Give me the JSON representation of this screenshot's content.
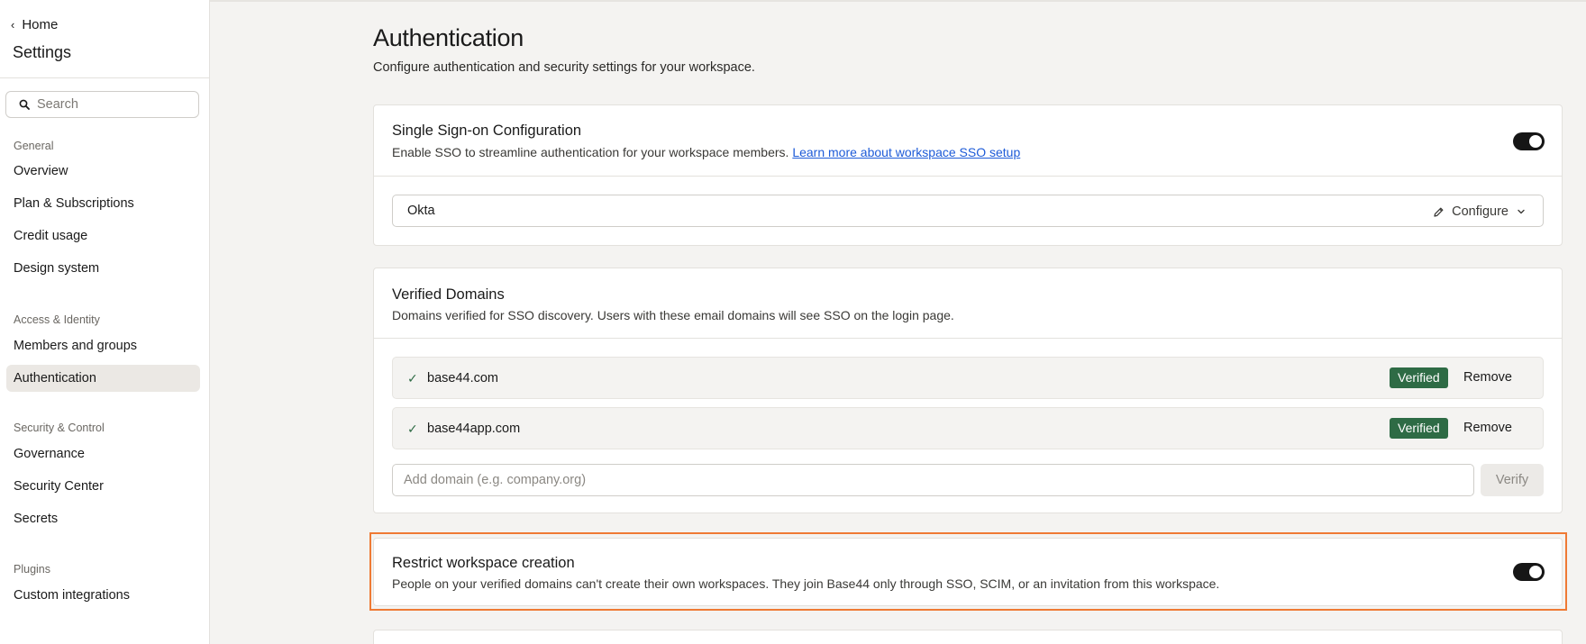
{
  "sidebar": {
    "back_label": "Home",
    "title": "Settings",
    "search_placeholder": "Search",
    "sections": [
      {
        "heading": "General",
        "items": [
          "Overview",
          "Plan & Subscriptions",
          "Credit usage",
          "Design system"
        ]
      },
      {
        "heading": "Access & Identity",
        "items": [
          "Members and groups",
          "Authentication"
        ]
      },
      {
        "heading": "Security & Control",
        "items": [
          "Governance",
          "Security Center",
          "Secrets"
        ]
      },
      {
        "heading": "Plugins",
        "items": [
          "Custom integrations"
        ]
      }
    ],
    "active_item": "Authentication"
  },
  "page": {
    "title": "Authentication",
    "subtitle": "Configure authentication and security settings for your workspace."
  },
  "sso": {
    "title": "Single Sign-on Configuration",
    "description": "Enable SSO to streamline authentication for your workspace members.",
    "link_text": "Learn more about workspace SSO setup",
    "enabled": true,
    "provider": "Okta",
    "configure_label": "Configure"
  },
  "domains": {
    "title": "Verified Domains",
    "description": "Domains verified for SSO discovery. Users with these email domains will see SSO on the login page.",
    "items": [
      {
        "name": "base44.com",
        "status": "Verified",
        "action": "Remove"
      },
      {
        "name": "base44app.com",
        "status": "Verified",
        "action": "Remove"
      }
    ],
    "add_placeholder": "Add domain (e.g. company.org)",
    "verify_label": "Verify"
  },
  "restrict": {
    "title": "Restrict workspace creation",
    "description": "People on your verified domains can't create their own workspaces. They join Base44 only through SSO, SCIM, or an invitation from this workspace.",
    "enabled": true
  },
  "colors": {
    "accent_toggle": "#161616",
    "verified_badge": "#2e6b45",
    "link": "#1d5bd8",
    "highlight_outline": "#ef7a34"
  }
}
